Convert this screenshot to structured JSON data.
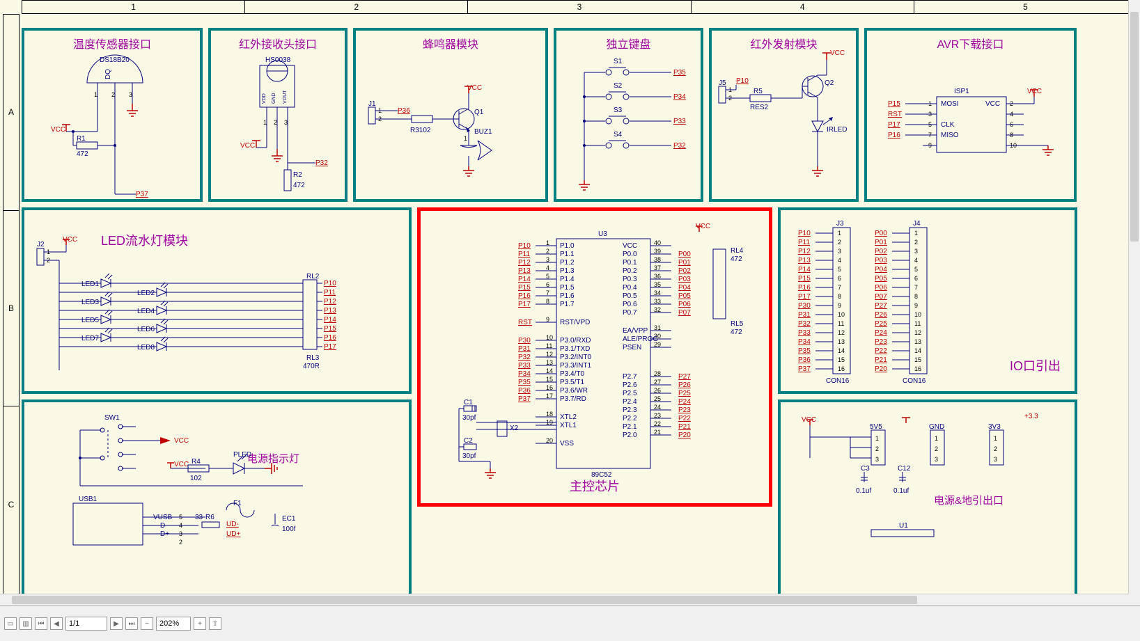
{
  "ruler_cols": [
    "1",
    "2",
    "3",
    "4",
    "5"
  ],
  "ruler_rows": [
    "A",
    "B",
    "C"
  ],
  "modules": {
    "temp": {
      "title": "温度传感器接口"
    },
    "ir_rx": {
      "title": "红外接收头接口"
    },
    "buzzer": {
      "title": "蜂鸣器模块"
    },
    "keys": {
      "title": "独立键盘"
    },
    "ir_tx": {
      "title": "红外发射模块"
    },
    "avr": {
      "title": "AVR下载接口"
    },
    "led": {
      "title": "LED流水灯模块"
    },
    "mcu": {
      "title": "主控芯片"
    },
    "io": {
      "title": "IO口引出"
    },
    "pwr_ind": {
      "title": "电源指示灯"
    },
    "pwr_out": {
      "title": "电源&地引出口"
    }
  },
  "temp": {
    "part": "DS18B20",
    "dq": "DQ",
    "vcc": "VCC",
    "r1": "R1",
    "r1v": "472",
    "net": "P37",
    "pins": [
      "1",
      "2",
      "3"
    ]
  },
  "ir_rx": {
    "part": "HS0038",
    "vcc": "VCC",
    "r2": "R2",
    "r2v": "472",
    "net": "P32",
    "pin_labels": [
      "VDD",
      "GND",
      "VOUT"
    ],
    "pins": [
      "1",
      "2",
      "3"
    ]
  },
  "buzzer": {
    "j1": "J1",
    "j1p": [
      "1",
      "2"
    ],
    "net": "P36",
    "r3": "R3102",
    "q1": "Q1",
    "buz": "BUZ1",
    "buzp": "1",
    "vcc": "VCC"
  },
  "keys": {
    "sw": [
      "S1",
      "S2",
      "S3",
      "S4"
    ],
    "nets": [
      "P35",
      "P34",
      "P33",
      "P32"
    ]
  },
  "ir_tx": {
    "vcc": "VCC",
    "j5": "J5",
    "j5p": [
      "1",
      "2"
    ],
    "net": "P10",
    "r5": "R5",
    "r5v": "RES2",
    "q2": "Q2",
    "led": "IRLED"
  },
  "avr": {
    "isp": "ISP1",
    "vcc": "VCC",
    "left_nets": [
      "P15",
      "RST",
      "P17",
      "P16"
    ],
    "left_pins": [
      "1",
      "3",
      "5",
      "7",
      "9"
    ],
    "right_pins": [
      "2",
      "4",
      "6",
      "8",
      "10"
    ],
    "left_labels": [
      "MOSI",
      "",
      "CLK",
      "MISO"
    ],
    "right_labels": [
      "VCC",
      "",
      "",
      "",
      ""
    ]
  },
  "led": {
    "j2": "J2",
    "j2p": [
      "1",
      "2"
    ],
    "vcc": "VCC",
    "leds": [
      "LED1",
      "LED2",
      "LED3",
      "LED4",
      "LED5",
      "LED6",
      "LED7",
      "LED8"
    ],
    "rl2": "RL2",
    "rl3": "RL3",
    "rl3v": "470R",
    "nets": [
      "P10",
      "P11",
      "P12",
      "P13",
      "P14",
      "P15",
      "P16",
      "P17"
    ]
  },
  "mcu": {
    "u3": "U3",
    "part": "89C52",
    "left_pins": [
      {
        "num": "1",
        "name": "P1.0",
        "net": "P10"
      },
      {
        "num": "2",
        "name": "P1.1",
        "net": "P11"
      },
      {
        "num": "3",
        "name": "P1.2",
        "net": "P12"
      },
      {
        "num": "4",
        "name": "P1.3",
        "net": "P13"
      },
      {
        "num": "5",
        "name": "P1.4",
        "net": "P14"
      },
      {
        "num": "6",
        "name": "P1.5",
        "net": "P15"
      },
      {
        "num": "7",
        "name": "P1.6",
        "net": "P16"
      },
      {
        "num": "8",
        "name": "P1.7",
        "net": "P17"
      },
      {
        "num": "9",
        "name": "RST/VPD",
        "net": "RST"
      },
      {
        "num": "10",
        "name": "P3.0/RXD",
        "net": "P30"
      },
      {
        "num": "11",
        "name": "P3.1/TXD",
        "net": "P31"
      },
      {
        "num": "12",
        "name": "P3.2/INT0",
        "net": "P32"
      },
      {
        "num": "13",
        "name": "P3.3/INT1",
        "net": "P33"
      },
      {
        "num": "14",
        "name": "P3.4/T0",
        "net": "P34"
      },
      {
        "num": "15",
        "name": "P3.5/T1",
        "net": "P35"
      },
      {
        "num": "16",
        "name": "P3.6/WR",
        "net": "P36"
      },
      {
        "num": "17",
        "name": "P3.7/RD",
        "net": "P37"
      },
      {
        "num": "18",
        "name": "XTL2",
        "net": ""
      },
      {
        "num": "19",
        "name": "XTL1",
        "net": ""
      },
      {
        "num": "20",
        "name": "VSS",
        "net": ""
      }
    ],
    "right_pins": [
      {
        "num": "40",
        "name": "VCC",
        "net": ""
      },
      {
        "num": "39",
        "name": "P0.0",
        "net": "P00"
      },
      {
        "num": "38",
        "name": "P0.1",
        "net": "P01"
      },
      {
        "num": "37",
        "name": "P0.2",
        "net": "P02"
      },
      {
        "num": "36",
        "name": "P0.3",
        "net": "P03"
      },
      {
        "num": "35",
        "name": "P0.4",
        "net": "P04"
      },
      {
        "num": "34",
        "name": "P0.5",
        "net": "P05"
      },
      {
        "num": "33",
        "name": "P0.6",
        "net": "P06"
      },
      {
        "num": "32",
        "name": "P0.7",
        "net": "P07"
      },
      {
        "num": "31",
        "name": "EA/VPP",
        "net": ""
      },
      {
        "num": "30",
        "name": "ALE/PROG",
        "net": ""
      },
      {
        "num": "29",
        "name": "PSEN",
        "net": ""
      },
      {
        "num": "28",
        "name": "P2.7",
        "net": "P27"
      },
      {
        "num": "27",
        "name": "P2.6",
        "net": "P26"
      },
      {
        "num": "26",
        "name": "P2.5",
        "net": "P25"
      },
      {
        "num": "25",
        "name": "P2.4",
        "net": "P24"
      },
      {
        "num": "24",
        "name": "P2.3",
        "net": "P23"
      },
      {
        "num": "23",
        "name": "P2.2",
        "net": "P22"
      },
      {
        "num": "22",
        "name": "P2.1",
        "net": "P21"
      },
      {
        "num": "21",
        "name": "P2.0",
        "net": "P20"
      }
    ],
    "c1": "C1",
    "c1v": "30pf",
    "c2": "C2",
    "c2v": "30pf",
    "x2": "X2",
    "vcc": "VCC",
    "rl4": "RL4",
    "rl4v": "472",
    "rl5": "RL5",
    "rl5v": "472"
  },
  "io": {
    "j3": "J3",
    "j4": "J4",
    "con": "CON16",
    "j3_nets": [
      "P10",
      "P11",
      "P12",
      "P13",
      "P14",
      "P15",
      "P16",
      "P17",
      "P30",
      "P31",
      "P32",
      "P33",
      "P34",
      "P35",
      "P36",
      "P37"
    ],
    "j4_nets": [
      "P00",
      "P01",
      "P02",
      "P03",
      "P04",
      "P05",
      "P06",
      "P07",
      "P27",
      "P26",
      "P25",
      "P24",
      "P23",
      "P22",
      "P21",
      "P20"
    ],
    "nums": [
      "1",
      "2",
      "3",
      "4",
      "5",
      "6",
      "7",
      "8",
      "9",
      "10",
      "11",
      "12",
      "13",
      "14",
      "15",
      "16"
    ]
  },
  "pwr_ind": {
    "sw1": "SW1",
    "vcc": "VCC",
    "r4": "R4",
    "r4v": "102",
    "pled": "PLED",
    "usb1": "USB1",
    "vusb": "VUSB",
    "dminus": "D-",
    "dplus": "D+",
    "usb_pins": [
      "5",
      "4",
      "3",
      "2"
    ],
    "r6": "R6",
    "r6v": "33",
    "ud_m": "UD-",
    "ud_p": "UD+",
    "f1": "F1",
    "ec1": "EC1",
    "ec1v": "100f"
  },
  "pwr_out": {
    "vcc": "VCC",
    "p33": "+3.3",
    "h5v": "5V5",
    "hgnd": "GND",
    "h3v": "3V3",
    "pins": [
      "1",
      "2",
      "3"
    ],
    "c3": "C3",
    "c3v": "0.1uf",
    "c12": "C12",
    "c12v": "0.1uf",
    "u1": "U1"
  },
  "nav": {
    "page": "1/1",
    "zoom": "202%"
  }
}
